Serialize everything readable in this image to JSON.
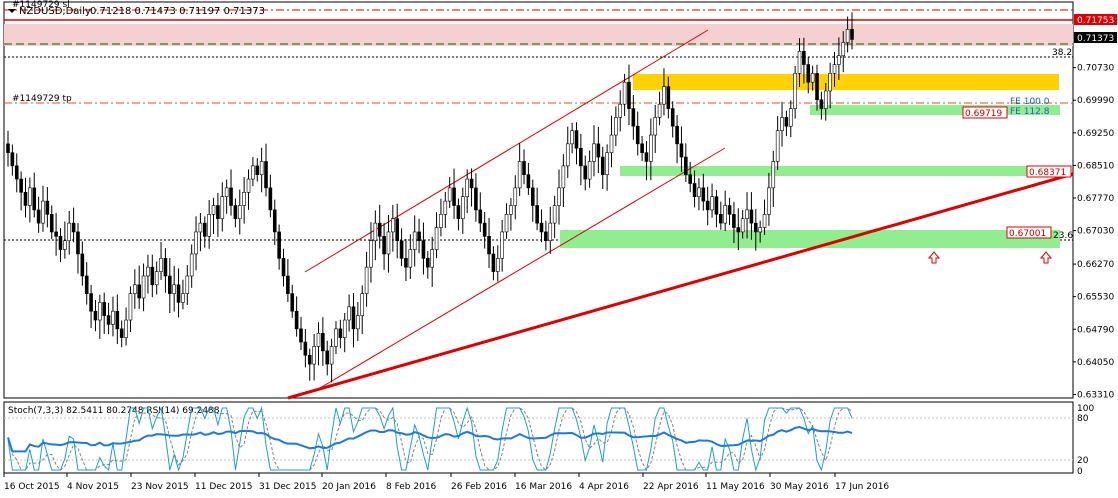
{
  "window": {
    "symbol_title": "NZDUSD,Daily",
    "ohlc": "0.71218 0.71473 0.71197 0.71373",
    "top_left_label": "#1149729 sl"
  },
  "colors": {
    "bull": "#000000",
    "bear": "#000000",
    "price_line": "#000000",
    "red_line": "#e00000",
    "gold_zone": "#ffd200",
    "green_zone": "#90ee90",
    "pink_zone": "#f6d0d0",
    "stoch_main": "#20a0c0",
    "stoch_signal": "#808080",
    "rsi": "#1e78e0"
  },
  "price_axis": {
    "min": 0.6323,
    "max": 0.7222,
    "labels": [
      "0.70730",
      "0.69990",
      "0.69250",
      "0.68510",
      "0.67770",
      "0.67030",
      "0.66270",
      "0.65530",
      "0.64790",
      "0.64050",
      "0.63310"
    ]
  },
  "price_tags": {
    "current": "0.71373",
    "red_top": "0.71753",
    "level_1": "0.69719",
    "level_2": "0.68371",
    "level_3": "0.67001"
  },
  "annotations": {
    "tp_label": "#1149729 tp",
    "fib_38": "38.2",
    "fib_23": "23.6",
    "fe_100": "FE 100.0",
    "fe_112": "FE 112.8"
  },
  "indicator": {
    "title": "Stoch(7,3,3) 82.5411 80.2748  RSI(14) 69.2488",
    "levels": [
      "100",
      "80",
      "20",
      "0"
    ]
  },
  "time_axis": {
    "labels": [
      "16 Oct 2015",
      "4 Nov 2015",
      "23 Nov 2015",
      "11 Dec 2015",
      "31 Dec 2015",
      "20 Jan 2016",
      "8 Feb 2016",
      "26 Feb 2016",
      "16 Mar 2016",
      "4 Apr 2016",
      "22 Apr 2016",
      "11 May 2016",
      "30 May 2016",
      "17 Jun 2016"
    ]
  },
  "chart_data": {
    "type": "candlestick",
    "title": "NZDUSD,Daily",
    "ylim": [
      0.6323,
      0.7222
    ],
    "closes": [
      0.688,
      0.685,
      0.682,
      0.679,
      0.676,
      0.68,
      0.675,
      0.672,
      0.677,
      0.674,
      0.67,
      0.669,
      0.666,
      0.668,
      0.672,
      0.67,
      0.665,
      0.66,
      0.656,
      0.652,
      0.65,
      0.654,
      0.651,
      0.649,
      0.652,
      0.648,
      0.646,
      0.65,
      0.656,
      0.658,
      0.655,
      0.66,
      0.662,
      0.658,
      0.661,
      0.664,
      0.66,
      0.656,
      0.658,
      0.654,
      0.656,
      0.66,
      0.665,
      0.67,
      0.672,
      0.669,
      0.674,
      0.676,
      0.673,
      0.678,
      0.68,
      0.676,
      0.673,
      0.676,
      0.679,
      0.682,
      0.685,
      0.683,
      0.686,
      0.68,
      0.675,
      0.67,
      0.664,
      0.66,
      0.656,
      0.652,
      0.648,
      0.645,
      0.642,
      0.64,
      0.644,
      0.647,
      0.643,
      0.64,
      0.644,
      0.648,
      0.646,
      0.65,
      0.653,
      0.648,
      0.651,
      0.656,
      0.662,
      0.668,
      0.672,
      0.669,
      0.665,
      0.67,
      0.673,
      0.668,
      0.664,
      0.662,
      0.666,
      0.67,
      0.668,
      0.664,
      0.662,
      0.666,
      0.671,
      0.674,
      0.677,
      0.68,
      0.676,
      0.673,
      0.678,
      0.682,
      0.68,
      0.675,
      0.672,
      0.669,
      0.665,
      0.661,
      0.664,
      0.67,
      0.674,
      0.676,
      0.68,
      0.686,
      0.683,
      0.68,
      0.676,
      0.672,
      0.67,
      0.668,
      0.672,
      0.676,
      0.68,
      0.685,
      0.69,
      0.693,
      0.689,
      0.685,
      0.682,
      0.686,
      0.69,
      0.687,
      0.683,
      0.688,
      0.692,
      0.696,
      0.699,
      0.704,
      0.698,
      0.694,
      0.69,
      0.688,
      0.686,
      0.692,
      0.696,
      0.699,
      0.703,
      0.698,
      0.694,
      0.69,
      0.687,
      0.683,
      0.681,
      0.678,
      0.68,
      0.677,
      0.675,
      0.678,
      0.674,
      0.672,
      0.676,
      0.674,
      0.671,
      0.67,
      0.673,
      0.675,
      0.672,
      0.67,
      0.671,
      0.674,
      0.68,
      0.686,
      0.693,
      0.696,
      0.694,
      0.698,
      0.706,
      0.711,
      0.708,
      0.704,
      0.706,
      0.7,
      0.698,
      0.702,
      0.706,
      0.708,
      0.71,
      0.713,
      0.716,
      0.7137
    ]
  }
}
